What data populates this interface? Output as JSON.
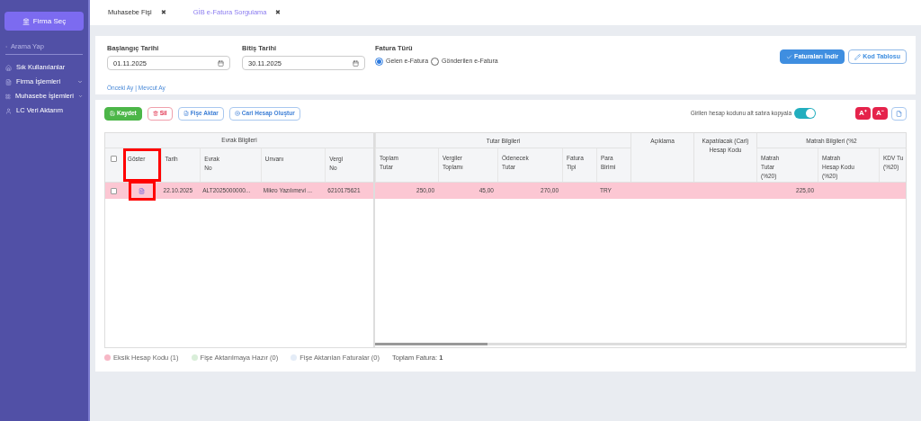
{
  "sidebar": {
    "firm_button": "Firma Seç",
    "search": {
      "placeholder": "Arama Yap"
    },
    "items": [
      {
        "label": "Sık Kullanılanlar",
        "has_submenu": false
      },
      {
        "label": "Firma İşlemleri",
        "has_submenu": true
      },
      {
        "label": "Muhasebe İşlemleri",
        "has_submenu": true
      },
      {
        "label": "LC Veri Aktarım",
        "has_submenu": false
      }
    ]
  },
  "tabs": [
    {
      "label": "Muhasebe Fişi",
      "selected": false,
      "close": "✖"
    },
    {
      "label": "GİB e-Fatura Sorgulama",
      "selected": true,
      "close": "✖"
    }
  ],
  "filters": {
    "start_date": {
      "label": "Başlangıç Tarihi",
      "value": "01.11.2025"
    },
    "end_date": {
      "label": "Bitiş Tarihi",
      "value": "30.11.2025"
    },
    "invoice_type": {
      "label": "Fatura Türü",
      "options": [
        {
          "label": "Gelen e-Fatura",
          "selected": true
        },
        {
          "label": "Gönderilen e-Fatura",
          "selected": false
        }
      ]
    },
    "links": [
      "Önceki Ay",
      "Mevcut Ay"
    ],
    "link_separator": "|",
    "buttons": [
      {
        "label": "Faturaları İndir",
        "kind": "primary"
      },
      {
        "label": "Kod Tablosu",
        "kind": "outline"
      }
    ]
  },
  "toolbar": {
    "buttons": [
      {
        "label": "Kaydet",
        "kind": "success"
      },
      {
        "label": "Sil",
        "kind": "danger"
      },
      {
        "label": "Fişe Aktar",
        "kind": "info"
      },
      {
        "label": "Cari Hesap Oluştur",
        "kind": "info"
      }
    ],
    "copy_toggle": {
      "label": "Girilen hesap kodunu alt satıra kopyala",
      "on": true
    },
    "font_buttons": [
      "A⁺",
      "A⁻"
    ]
  },
  "table": {
    "all_checked": false,
    "left": {
      "group": "Evrak Bilgileri",
      "columns": [
        {
          "label": "Göster",
          "highlighted": true
        },
        {
          "label": "Tarih",
          "highlighted": false
        },
        {
          "label": "Evrak\nNo",
          "highlighted": false
        },
        {
          "label": "Unvanı",
          "highlighted": false
        },
        {
          "label": "Vergi\nNo",
          "highlighted": false
        }
      ]
    },
    "right": {
      "groups": [
        "Tutar Bilgileri",
        "Açıklama",
        "Kapatılacak (Cari)\nHesap Kodu",
        "Matrah Bilgileri (%2"
      ],
      "columns": [
        "Toplam\nTutar",
        "Vergiler\nToplamı",
        "Ödenecek\nTutar",
        "Fatura\nTipi",
        "Para\nBirimi",
        null,
        null,
        "Matrah\nTutar\n(%20)",
        "Matrah\nHesap Kodu\n(%20)",
        "KDV Tu\n(%20)"
      ]
    },
    "rows": [
      {
        "checked": false,
        "color": "#fcc7d3",
        "left": {
          "date": "22.10.2025",
          "doc_no": "ALT2025000000...",
          "title": "Mikro Yazılımevi ...",
          "tax_no": "6210175621"
        },
        "right": {
          "total": "250,00",
          "taxes": "45,00",
          "payable": "270,00",
          "currency": "TRY",
          "base_amount": "225,00"
        }
      }
    ]
  },
  "legend": [
    {
      "label": "Eksik Hesap Kodu (1)",
      "color": "#f7b8c6"
    },
    {
      "label": "Fişe Aktarılmaya Hazır (0)",
      "color": "#d9eed9"
    },
    {
      "label": "Fişe Aktarılan Faturalar (0)",
      "color": "#e4ecf7"
    }
  ],
  "total": {
    "label": "Toplam Fatura:",
    "value": "1"
  }
}
